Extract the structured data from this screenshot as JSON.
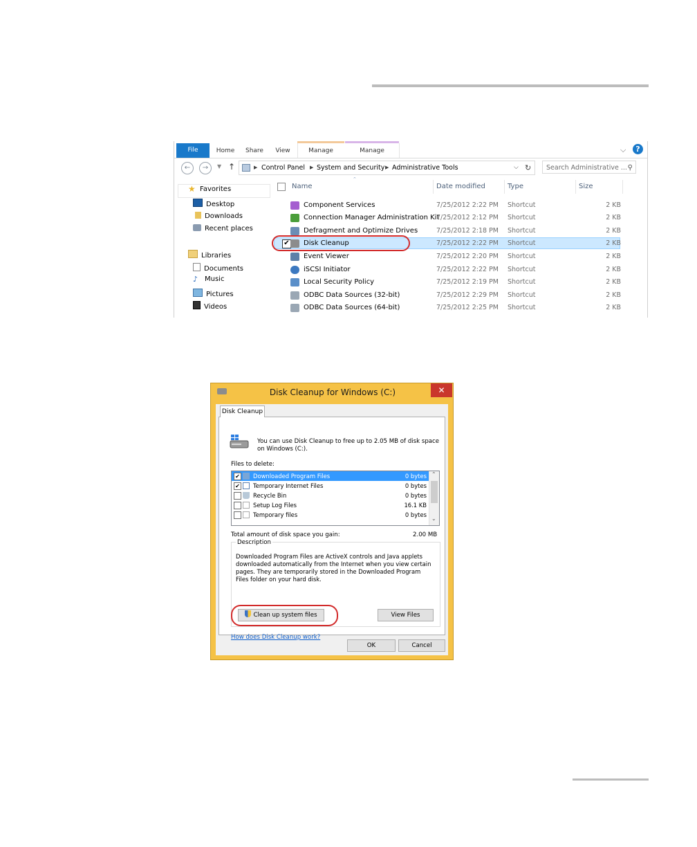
{
  "explorer": {
    "ribbon_tabs": [
      "File",
      "Home",
      "Share",
      "View",
      "Manage",
      "Manage"
    ],
    "help": "?",
    "address": {
      "segments": [
        "Control Panel",
        "System and Security",
        "Administrative Tools"
      ],
      "search_placeholder": "Search Administrative ..."
    },
    "nav": {
      "favorites": "Favorites",
      "desktop": "Desktop",
      "downloads": "Downloads",
      "recent": "Recent places",
      "libraries": "Libraries",
      "documents": "Documents",
      "music": "Music",
      "pictures": "Pictures",
      "videos": "Videos"
    },
    "columns": {
      "name": "Name",
      "date": "Date modified",
      "type": "Type",
      "size": "Size"
    },
    "rows": [
      {
        "name": "Component Services",
        "date": "7/25/2012 2:22 PM",
        "type": "Shortcut",
        "size": "2 KB"
      },
      {
        "name": "Connection Manager Administration Kit",
        "date": "7/25/2012 2:12 PM",
        "type": "Shortcut",
        "size": "2 KB"
      },
      {
        "name": "Defragment and Optimize Drives",
        "date": "7/25/2012 2:18 PM",
        "type": "Shortcut",
        "size": "2 KB"
      },
      {
        "name": "Disk Cleanup",
        "date": "7/25/2012 2:22 PM",
        "type": "Shortcut",
        "size": "2 KB"
      },
      {
        "name": "Event Viewer",
        "date": "7/25/2012 2:20 PM",
        "type": "Shortcut",
        "size": "2 KB"
      },
      {
        "name": "iSCSI Initiator",
        "date": "7/25/2012 2:22 PM",
        "type": "Shortcut",
        "size": "2 KB"
      },
      {
        "name": "Local Security Policy",
        "date": "7/25/2012 2:19 PM",
        "type": "Shortcut",
        "size": "2 KB"
      },
      {
        "name": "ODBC Data Sources (32-bit)",
        "date": "7/25/2012 2:29 PM",
        "type": "Shortcut",
        "size": "2 KB"
      },
      {
        "name": "ODBC Data Sources (64-bit)",
        "date": "7/25/2012 2:25 PM",
        "type": "Shortcut",
        "size": "2 KB"
      }
    ]
  },
  "dialog": {
    "title": "Disk Cleanup for Windows (C:)",
    "tab": "Disk Cleanup",
    "intro": "You can use Disk Cleanup to free up to 2.05 MB of disk space on Windows (C:).",
    "files_label": "Files to delete:",
    "items": [
      {
        "name": "Downloaded Program Files",
        "size": "0 bytes",
        "checked": true
      },
      {
        "name": "Temporary Internet Files",
        "size": "0 bytes",
        "checked": true
      },
      {
        "name": "Recycle Bin",
        "size": "0 bytes",
        "checked": false
      },
      {
        "name": "Setup Log Files",
        "size": "16.1 KB",
        "checked": false
      },
      {
        "name": "Temporary files",
        "size": "0 bytes",
        "checked": false
      }
    ],
    "total_label": "Total amount of disk space you gain:",
    "total_value": "2.00 MB",
    "description_label": "Description",
    "description": "Downloaded Program Files are ActiveX controls and Java applets downloaded automatically from the Internet when you view certain pages. They are temporarily stored in the Downloaded Program Files folder on your hard disk.",
    "cleanup_button": "Clean up system files",
    "view_files_button": "View Files",
    "help_link": "How does Disk Cleanup work?",
    "ok": "OK",
    "cancel": "Cancel",
    "close_glyph": "✕"
  }
}
